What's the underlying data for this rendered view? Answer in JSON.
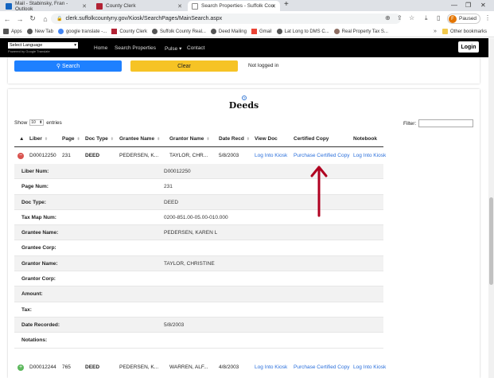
{
  "browser": {
    "tabs": [
      {
        "title": "Mail - Stabinsky, Fran - Outlook",
        "favicon_color": "#1565c0"
      },
      {
        "title": "County Clerk",
        "favicon_color": "#b22234"
      },
      {
        "title": "Search Properties - Suffolk Coun",
        "favicon_color": "#777777"
      }
    ],
    "new_tab_label": "+",
    "url": "clerk.suffolkcountyny.gov/Kiosk/SearchPages/MainSearch.aspx",
    "profile_label": "Paused",
    "profile_initial": "F",
    "bookmarks": [
      {
        "label": "Apps",
        "color": "#555555"
      },
      {
        "label": "New Tab",
        "color": "#555555"
      },
      {
        "label": "google translate -...",
        "color": "#4285f4"
      },
      {
        "label": "County Clerk",
        "color": "#b22234"
      },
      {
        "label": "Suffolk County Real...",
        "color": "#555555"
      },
      {
        "label": "Deed Mailing",
        "color": "#555555"
      },
      {
        "label": "Gmail",
        "color": "#ea4335"
      },
      {
        "label": "Lat Long to DMS C...",
        "color": "#555555"
      },
      {
        "label": "Real Property Tax S...",
        "color": "#8d6e63"
      }
    ],
    "other_bookmarks": "Other bookmarks"
  },
  "site": {
    "language_select": "Select Language",
    "powered_by": "Powered by Google Translate",
    "nav": [
      "Home",
      "Search Properties",
      "Pulse ▾",
      "Contact"
    ],
    "login_label": "Login"
  },
  "search": {
    "search_label": "Search",
    "clear_label": "Clear",
    "status": "Not logged in",
    "search_color": "#1e80ff",
    "clear_color": "#f6c325"
  },
  "deeds": {
    "title": "Deeds",
    "help_icon": "?",
    "show_label": "Show",
    "entries_count": "10",
    "entries_label": "entries",
    "filter_label": "Filter:",
    "columns": [
      "Liber",
      "Page",
      "Doc Type",
      "Grantee Name",
      "Grantor Name",
      "Date Recd",
      "View Doc",
      "Certified Copy",
      "Notebook"
    ],
    "rows": [
      {
        "liber": "D00012250",
        "page": "231",
        "doc_type": "DEED",
        "grantee": "PEDERSEN, K...",
        "grantor": "TAYLOR, CHR...",
        "date": "5/8/2003",
        "view": "Log Into Kiosk",
        "certified": "Purchase Certified Copy",
        "notebook": "Log Into Kiosk",
        "expanded": true
      },
      {
        "liber": "D00012244",
        "page": "765",
        "doc_type": "DEED",
        "grantee": "PEDERSEN, K...",
        "grantor": "WARREN, ALF...",
        "date": "4/8/2003",
        "view": "Log Into Kiosk",
        "certified": "Purchase Certified Copy",
        "notebook": "Log Into Kiosk",
        "expanded": false
      }
    ],
    "details": [
      {
        "key": "Liber Num:",
        "value": "D00012250"
      },
      {
        "key": "Page Num:",
        "value": "231"
      },
      {
        "key": "Doc Type:",
        "value": "DEED"
      },
      {
        "key": "Tax Map Num:",
        "value": "0200-851.00-05.00-010.000"
      },
      {
        "key": "Grantee Name:",
        "value": "PEDERSEN, KAREN L"
      },
      {
        "key": "Grantee Corp:",
        "value": ""
      },
      {
        "key": "Grantor Name:",
        "value": "TAYLOR, CHRISTINE"
      },
      {
        "key": "Grantor Corp:",
        "value": ""
      },
      {
        "key": "Amount:",
        "value": ""
      },
      {
        "key": "Tax:",
        "value": ""
      },
      {
        "key": "Date Recorded:",
        "value": "5/8/2003"
      },
      {
        "key": "Notations:",
        "value": ""
      }
    ],
    "collapse_color": "#d9534f",
    "expand_color": "#5cb85c",
    "link_color": "#2a6fdb"
  },
  "annotation": {
    "arrow_color": "#b00020"
  }
}
